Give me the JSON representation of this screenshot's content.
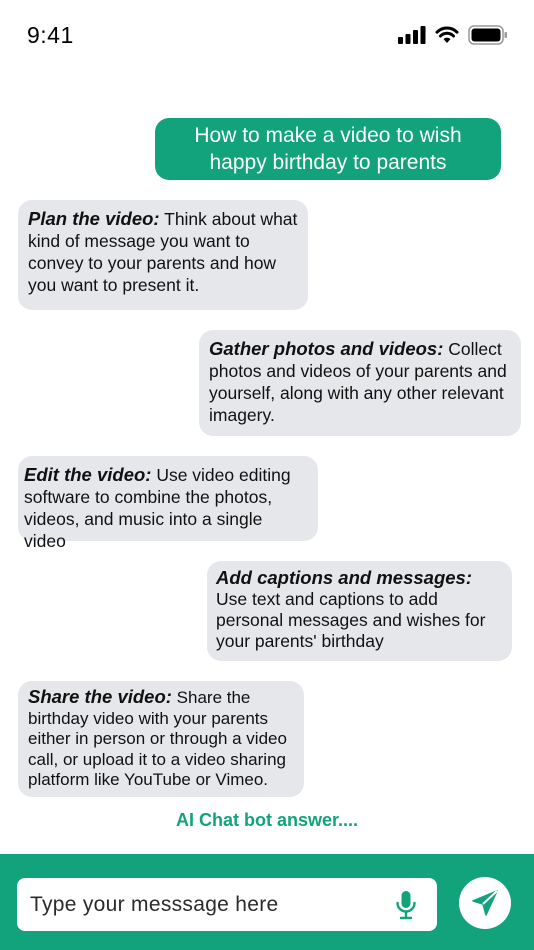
{
  "status_bar": {
    "time": "9:41"
  },
  "messages": [
    {
      "role": "user",
      "text": "How to make a video to wish happy birthday to parents"
    },
    {
      "role": "bot",
      "lead": "Plan the video:",
      "body": " Think about what kind of message you want to convey to your parents and how you want to present it."
    },
    {
      "role": "bot",
      "lead": "Gather photos and videos:",
      "body": " Collect photos and videos of your parents and yourself, along with any other relevant imagery."
    },
    {
      "role": "bot",
      "lead": "Edit the video:",
      "body": " Use video editing software to combine the photos, videos, and music into a single video"
    },
    {
      "role": "bot",
      "lead": "Add captions and messages:",
      "body": " Use text and captions to add personal messages and wishes for your parents' birthday"
    },
    {
      "role": "bot",
      "lead": "Share the video:",
      "body": " Share the birthday video with your parents either in person or through a video call, or upload it to a video sharing platform like YouTube or Vimeo."
    }
  ],
  "typing_indicator": "AI Chat bot answer....",
  "composer": {
    "placeholder": "Type your messsage here"
  },
  "icons": {
    "signal": "signal-icon",
    "wifi": "wifi-icon",
    "battery": "battery-icon",
    "mic": "microphone-icon",
    "send": "send-icon"
  },
  "colors": {
    "accent": "#12a37d",
    "bot_bubble": "#e6e7ea"
  }
}
